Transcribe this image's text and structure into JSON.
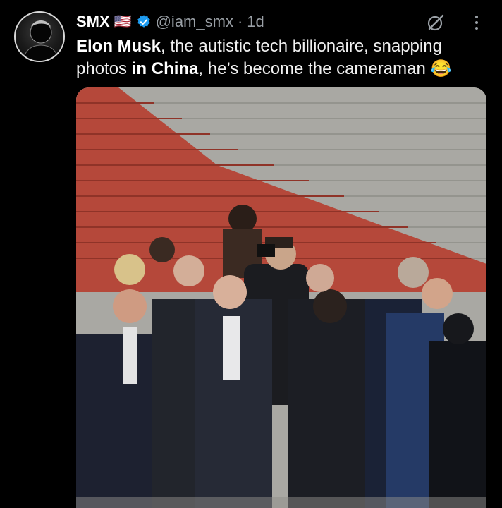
{
  "author": {
    "name": "SMX",
    "flag": "🇺🇸",
    "handle": "@iam_smx",
    "separator": "·",
    "time": "1d",
    "avatar_icon": "avatar-silhouette-icon"
  },
  "post": {
    "segments": [
      {
        "text": "Elon Musk",
        "bold": true
      },
      {
        "text": ", the autistic tech billionaire, snapping photos ",
        "bold": false
      },
      {
        "text": "in China",
        "bold": true
      },
      {
        "text": ", he’s become the cameraman ",
        "bold": false
      },
      {
        "text": "😂",
        "bold": false
      }
    ]
  },
  "icons": {
    "verified": "verified-badge-icon",
    "grok": "grok-icon",
    "more": "more-vertical-icon"
  },
  "colors": {
    "background": "#000000",
    "verified": "#1d9bf0",
    "secondary_text": "#9aa0a6",
    "stairs_red": "#b8473a",
    "stairs_gray": "#a7a6a1"
  }
}
